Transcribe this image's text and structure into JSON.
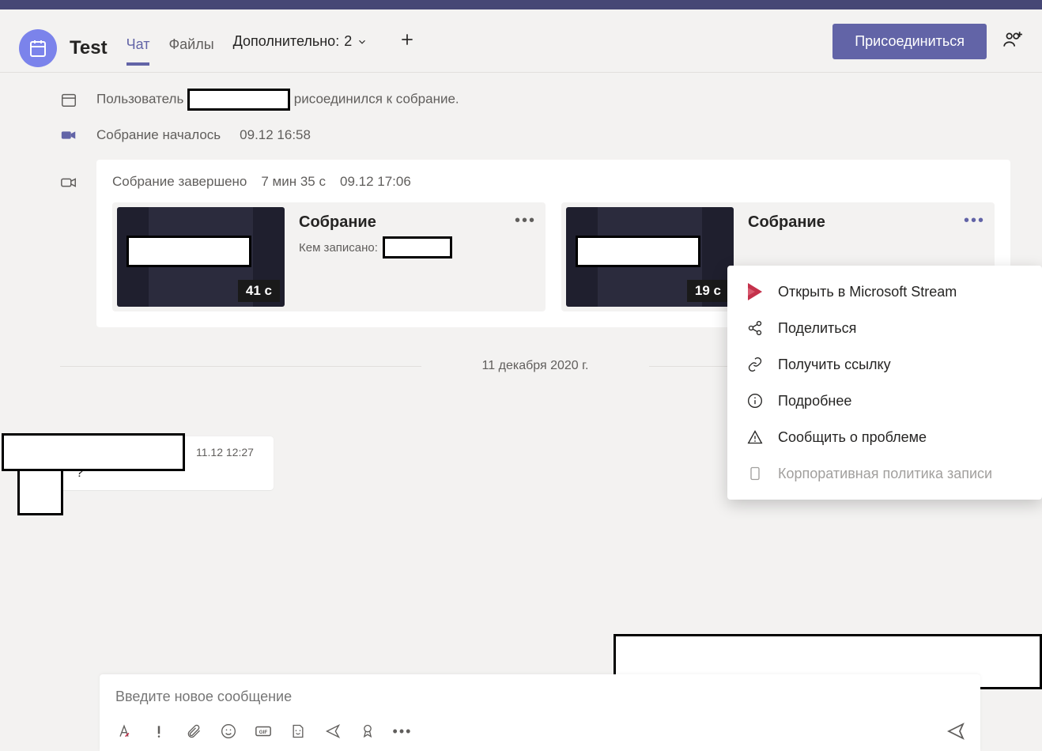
{
  "header": {
    "title": "Test",
    "tabs": {
      "chat": "Чат",
      "files": "Файлы"
    },
    "more": {
      "label": "Дополнительно:",
      "count": "2"
    },
    "join_button": "Присоединиться"
  },
  "events": {
    "joined_prefix": "Пользователь",
    "joined_suffix": "рисоединился к собрание.",
    "started_label": "Собрание началось",
    "started_time": "09.12 16:58"
  },
  "meeting_card": {
    "ended_label": "Собрание завершено",
    "duration": "7 мин 35 с",
    "time": "09.12 17:06",
    "recordings": [
      {
        "title": "Собрание",
        "recorded_by_label": "Кем записано:",
        "duration": "41 с"
      },
      {
        "title": "Собрание",
        "recorded_by_label": "",
        "duration": "19 с"
      }
    ]
  },
  "date_divider": "11 декабря 2020 г.",
  "message": {
    "time": "11.12 12:27",
    "text": "?"
  },
  "context_menu": {
    "open_stream": "Открыть в Microsoft Stream",
    "share": "Поделиться",
    "get_link": "Получить ссылку",
    "details": "Подробнее",
    "report": "Сообщить о проблеме",
    "policy": "Корпоративная политика записи"
  },
  "compose": {
    "placeholder": "Введите новое сообщение"
  }
}
